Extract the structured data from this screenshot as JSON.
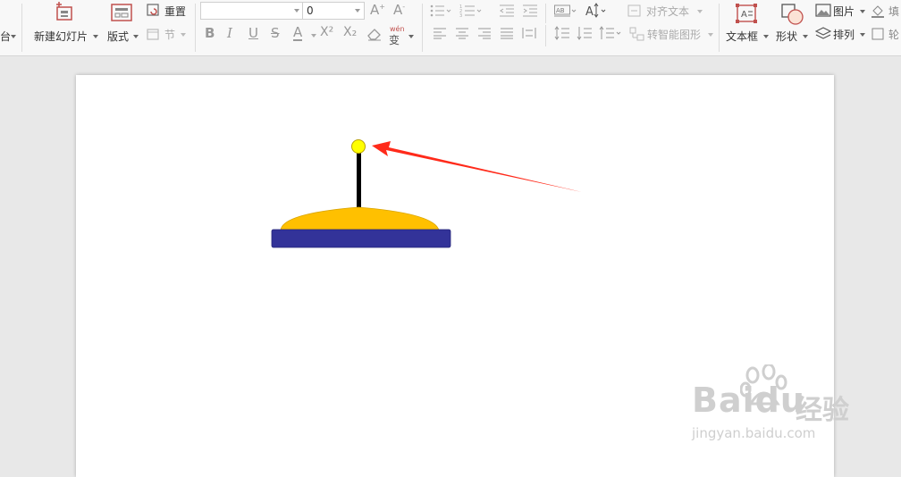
{
  "ribbon": {
    "cut_label": "台",
    "new_slide_label": "新建幻灯片",
    "layout_label": "版式",
    "reset_label": "重置",
    "section_label": "节",
    "font_name_value": "",
    "font_size_value": "0",
    "align_text_label": "对齐文本",
    "convert_smartart_label": "转智能图形",
    "textbox_label": "文本框",
    "shape_label": "形状",
    "picture_label": "图片",
    "arrange_label": "排列",
    "fill_label": "填",
    "outline_label": "轮",
    "pinyin_top": "wén",
    "pinyin_bottom": "变",
    "superscript_label": "X²",
    "subscript_label": "X₂"
  },
  "slide": {
    "colors": {
      "base": "#333399",
      "dome": "#ffc000",
      "pole": "#000000",
      "knob": "#ffff00",
      "arrow": "#ff2a1a"
    }
  },
  "watermark": {
    "brand": "Baidu",
    "brand_cn": "经验",
    "url": "jingyan.baidu.com"
  }
}
